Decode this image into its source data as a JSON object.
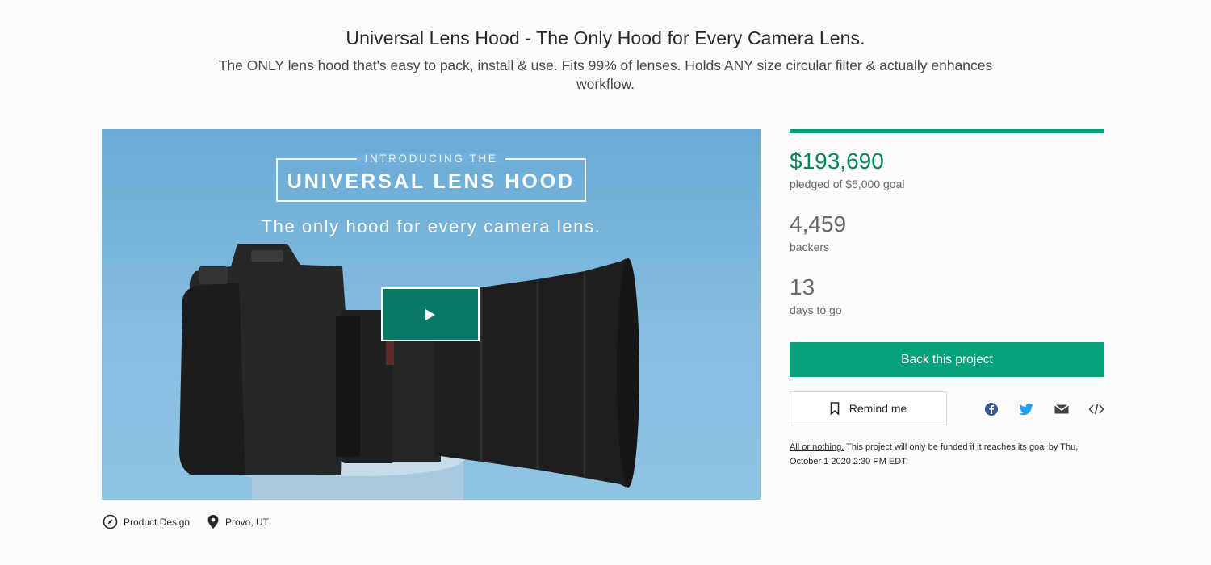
{
  "header": {
    "title": "Universal Lens Hood - The Only Hood for Every Camera Lens.",
    "subtitle": "The ONLY lens hood that's easy to pack, install & use. Fits 99% of lenses. Holds ANY size circular filter & actually enhances workflow."
  },
  "video": {
    "intro_small": "INTRODUCING THE",
    "intro_big": "UNIVERSAL LENS HOOD",
    "tagline": "The only hood for every camera lens.",
    "play_icon": "play-icon"
  },
  "meta": {
    "category": "Product Design",
    "category_icon": "compass-icon",
    "location": "Provo, UT",
    "location_icon": "map-pin-icon"
  },
  "stats": {
    "progress_fraction": 1.0,
    "pledged": "$193,690",
    "pledged_label": "pledged of $5,000 goal",
    "backers": "4,459",
    "backers_label": "backers",
    "days": "13",
    "days_label": "days to go"
  },
  "actions": {
    "back_label": "Back this project",
    "remind_label": "Remind me",
    "remind_icon": "bookmark-icon",
    "share_icons": [
      "facebook-icon",
      "twitter-icon",
      "email-icon",
      "embed-icon"
    ]
  },
  "note": {
    "link": "All or nothing.",
    "text": " This project will only be funded if it reaches its goal by Thu, October 1 2020 2:30 PM EDT."
  },
  "colors": {
    "accent": "#05a17a",
    "pledged_green": "#028858",
    "play_bg": "#087867",
    "facebook": "#3b5998",
    "twitter": "#1da1f2"
  }
}
